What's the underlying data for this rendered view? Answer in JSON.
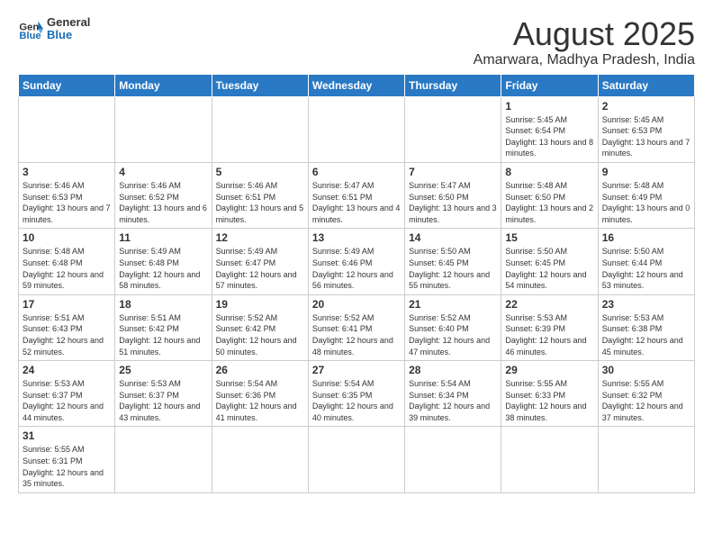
{
  "header": {
    "logo_general": "General",
    "logo_blue": "Blue",
    "month_title": "August 2025",
    "location": "Amarwara, Madhya Pradesh, India"
  },
  "weekdays": [
    "Sunday",
    "Monday",
    "Tuesday",
    "Wednesday",
    "Thursday",
    "Friday",
    "Saturday"
  ],
  "weeks": [
    [
      {
        "day": "",
        "info": ""
      },
      {
        "day": "",
        "info": ""
      },
      {
        "day": "",
        "info": ""
      },
      {
        "day": "",
        "info": ""
      },
      {
        "day": "",
        "info": ""
      },
      {
        "day": "1",
        "info": "Sunrise: 5:45 AM\nSunset: 6:54 PM\nDaylight: 13 hours and 8 minutes."
      },
      {
        "day": "2",
        "info": "Sunrise: 5:45 AM\nSunset: 6:53 PM\nDaylight: 13 hours and 7 minutes."
      }
    ],
    [
      {
        "day": "3",
        "info": "Sunrise: 5:46 AM\nSunset: 6:53 PM\nDaylight: 13 hours and 7 minutes."
      },
      {
        "day": "4",
        "info": "Sunrise: 5:46 AM\nSunset: 6:52 PM\nDaylight: 13 hours and 6 minutes."
      },
      {
        "day": "5",
        "info": "Sunrise: 5:46 AM\nSunset: 6:51 PM\nDaylight: 13 hours and 5 minutes."
      },
      {
        "day": "6",
        "info": "Sunrise: 5:47 AM\nSunset: 6:51 PM\nDaylight: 13 hours and 4 minutes."
      },
      {
        "day": "7",
        "info": "Sunrise: 5:47 AM\nSunset: 6:50 PM\nDaylight: 13 hours and 3 minutes."
      },
      {
        "day": "8",
        "info": "Sunrise: 5:48 AM\nSunset: 6:50 PM\nDaylight: 13 hours and 2 minutes."
      },
      {
        "day": "9",
        "info": "Sunrise: 5:48 AM\nSunset: 6:49 PM\nDaylight: 13 hours and 0 minutes."
      }
    ],
    [
      {
        "day": "10",
        "info": "Sunrise: 5:48 AM\nSunset: 6:48 PM\nDaylight: 12 hours and 59 minutes."
      },
      {
        "day": "11",
        "info": "Sunrise: 5:49 AM\nSunset: 6:48 PM\nDaylight: 12 hours and 58 minutes."
      },
      {
        "day": "12",
        "info": "Sunrise: 5:49 AM\nSunset: 6:47 PM\nDaylight: 12 hours and 57 minutes."
      },
      {
        "day": "13",
        "info": "Sunrise: 5:49 AM\nSunset: 6:46 PM\nDaylight: 12 hours and 56 minutes."
      },
      {
        "day": "14",
        "info": "Sunrise: 5:50 AM\nSunset: 6:45 PM\nDaylight: 12 hours and 55 minutes."
      },
      {
        "day": "15",
        "info": "Sunrise: 5:50 AM\nSunset: 6:45 PM\nDaylight: 12 hours and 54 minutes."
      },
      {
        "day": "16",
        "info": "Sunrise: 5:50 AM\nSunset: 6:44 PM\nDaylight: 12 hours and 53 minutes."
      }
    ],
    [
      {
        "day": "17",
        "info": "Sunrise: 5:51 AM\nSunset: 6:43 PM\nDaylight: 12 hours and 52 minutes."
      },
      {
        "day": "18",
        "info": "Sunrise: 5:51 AM\nSunset: 6:42 PM\nDaylight: 12 hours and 51 minutes."
      },
      {
        "day": "19",
        "info": "Sunrise: 5:52 AM\nSunset: 6:42 PM\nDaylight: 12 hours and 50 minutes."
      },
      {
        "day": "20",
        "info": "Sunrise: 5:52 AM\nSunset: 6:41 PM\nDaylight: 12 hours and 48 minutes."
      },
      {
        "day": "21",
        "info": "Sunrise: 5:52 AM\nSunset: 6:40 PM\nDaylight: 12 hours and 47 minutes."
      },
      {
        "day": "22",
        "info": "Sunrise: 5:53 AM\nSunset: 6:39 PM\nDaylight: 12 hours and 46 minutes."
      },
      {
        "day": "23",
        "info": "Sunrise: 5:53 AM\nSunset: 6:38 PM\nDaylight: 12 hours and 45 minutes."
      }
    ],
    [
      {
        "day": "24",
        "info": "Sunrise: 5:53 AM\nSunset: 6:37 PM\nDaylight: 12 hours and 44 minutes."
      },
      {
        "day": "25",
        "info": "Sunrise: 5:53 AM\nSunset: 6:37 PM\nDaylight: 12 hours and 43 minutes."
      },
      {
        "day": "26",
        "info": "Sunrise: 5:54 AM\nSunset: 6:36 PM\nDaylight: 12 hours and 41 minutes."
      },
      {
        "day": "27",
        "info": "Sunrise: 5:54 AM\nSunset: 6:35 PM\nDaylight: 12 hours and 40 minutes."
      },
      {
        "day": "28",
        "info": "Sunrise: 5:54 AM\nSunset: 6:34 PM\nDaylight: 12 hours and 39 minutes."
      },
      {
        "day": "29",
        "info": "Sunrise: 5:55 AM\nSunset: 6:33 PM\nDaylight: 12 hours and 38 minutes."
      },
      {
        "day": "30",
        "info": "Sunrise: 5:55 AM\nSunset: 6:32 PM\nDaylight: 12 hours and 37 minutes."
      }
    ],
    [
      {
        "day": "31",
        "info": "Sunrise: 5:55 AM\nSunset: 6:31 PM\nDaylight: 12 hours and 35 minutes."
      },
      {
        "day": "",
        "info": ""
      },
      {
        "day": "",
        "info": ""
      },
      {
        "day": "",
        "info": ""
      },
      {
        "day": "",
        "info": ""
      },
      {
        "day": "",
        "info": ""
      },
      {
        "day": "",
        "info": ""
      }
    ]
  ]
}
